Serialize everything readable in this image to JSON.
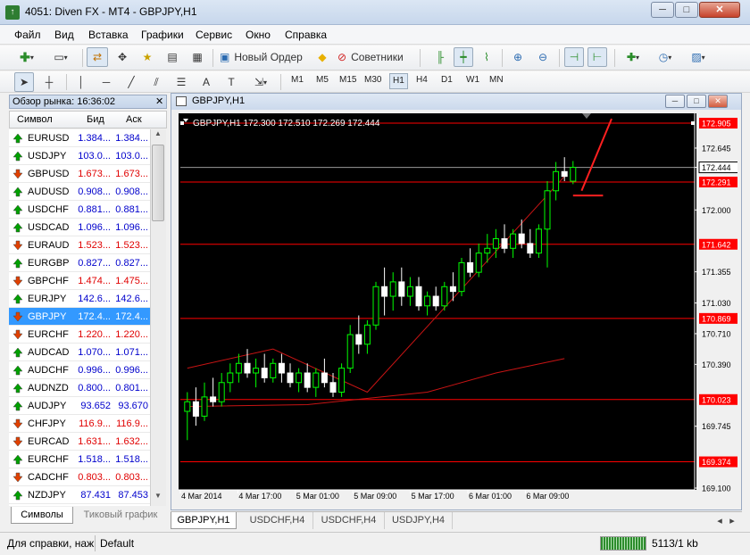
{
  "window": {
    "title": "4051: Diven FX - MT4 - GBPJPY,H1",
    "min": "─",
    "max": "□",
    "close": "✕"
  },
  "menu": [
    "Файл",
    "Вид",
    "Вставка",
    "Графики",
    "Сервис",
    "Окно",
    "Справка"
  ],
  "toolbar": {
    "new_order": "Новый Ордер",
    "advisors": "Советники"
  },
  "timeframes": [
    "M1",
    "M5",
    "M15",
    "M30",
    "H1",
    "H4",
    "D1",
    "W1",
    "MN"
  ],
  "market_watch": {
    "title": "Обзор рынка: 16:36:02",
    "close": "✕",
    "columns": {
      "symbol": "Символ",
      "bid": "Бид",
      "ask": "Аск"
    },
    "rows": [
      {
        "symbol": "EURUSD",
        "bid": "1.384...",
        "ask": "1.384...",
        "dir": "up"
      },
      {
        "symbol": "USDJPY",
        "bid": "103.0...",
        "ask": "103.0...",
        "dir": "up"
      },
      {
        "symbol": "GBPUSD",
        "bid": "1.673...",
        "ask": "1.673...",
        "dir": "down"
      },
      {
        "symbol": "AUDUSD",
        "bid": "0.908...",
        "ask": "0.908...",
        "dir": "up"
      },
      {
        "symbol": "USDCHF",
        "bid": "0.881...",
        "ask": "0.881...",
        "dir": "up"
      },
      {
        "symbol": "USDCAD",
        "bid": "1.096...",
        "ask": "1.096...",
        "dir": "up"
      },
      {
        "symbol": "EURAUD",
        "bid": "1.523...",
        "ask": "1.523...",
        "dir": "down"
      },
      {
        "symbol": "EURGBP",
        "bid": "0.827...",
        "ask": "0.827...",
        "dir": "up"
      },
      {
        "symbol": "GBPCHF",
        "bid": "1.474...",
        "ask": "1.475...",
        "dir": "down"
      },
      {
        "symbol": "EURJPY",
        "bid": "142.6...",
        "ask": "142.6...",
        "dir": "up"
      },
      {
        "symbol": "GBPJPY",
        "bid": "172.4...",
        "ask": "172.4...",
        "dir": "down",
        "selected": true
      },
      {
        "symbol": "EURCHF",
        "bid": "1.220...",
        "ask": "1.220...",
        "dir": "down"
      },
      {
        "symbol": "AUDCAD",
        "bid": "1.070...",
        "ask": "1.071...",
        "dir": "up"
      },
      {
        "symbol": "AUDCHF",
        "bid": "0.996...",
        "ask": "0.996...",
        "dir": "up"
      },
      {
        "symbol": "AUDNZD",
        "bid": "0.800...",
        "ask": "0.801...",
        "dir": "up"
      },
      {
        "symbol": "AUDJPY",
        "bid": "93.652",
        "ask": "93.670",
        "dir": "up"
      },
      {
        "symbol": "CHFJPY",
        "bid": "116.9...",
        "ask": "116.9...",
        "dir": "down"
      },
      {
        "symbol": "EURCAD",
        "bid": "1.631...",
        "ask": "1.632...",
        "dir": "down"
      },
      {
        "symbol": "EURCHF",
        "bid": "1.518...",
        "ask": "1.518...",
        "dir": "up"
      },
      {
        "symbol": "CADCHF",
        "bid": "0.803...",
        "ask": "0.803...",
        "dir": "down"
      },
      {
        "symbol": "NZDJPY",
        "bid": "87.431",
        "ask": "87.453",
        "dir": "up"
      }
    ],
    "tabs": [
      "Символы",
      "Тиковый график"
    ]
  },
  "chart_window": {
    "title": "GBPJPY,H1",
    "min": "─",
    "max": "□",
    "close": "✕"
  },
  "chart_tabs": [
    "GBPJPY,H1",
    "USDCHF,H4",
    "USDCHF,H4",
    "USDJPY,H4"
  ],
  "status": {
    "help": "Для справки, наж",
    "profile": "Default",
    "traffic": "5113/1 kb"
  },
  "colors": {
    "bg": "#000000",
    "bull": "#00ff00",
    "bear": "#ffffff",
    "level": "#ff0000",
    "up_arrow": "#00a000",
    "down_arrow": "#e04000"
  },
  "chart_data": {
    "type": "candlestick",
    "title": "GBPJPY,H1  172.300 172.510 172.269 172.444",
    "y_ticks": [
      "172.645",
      "172.444",
      "172.000",
      "171.355",
      "171.030",
      "170.710",
      "170.390",
      "169.745",
      "169.100"
    ],
    "ylim": [
      169.1,
      172.84
    ],
    "x_ticks": [
      "4 Mar 2014",
      "4 Mar 17:00",
      "5 Mar 01:00",
      "5 Mar 09:00",
      "5 Mar 17:00",
      "6 Mar 01:00",
      "6 Mar 09:00"
    ],
    "levels": [
      {
        "value": 172.905,
        "label": "172.905"
      },
      {
        "value": 172.291,
        "label": "172.291"
      },
      {
        "value": 171.642,
        "label": "171.642"
      },
      {
        "value": 170.869,
        "label": "170.869"
      },
      {
        "value": 170.023,
        "label": "170.023"
      },
      {
        "value": 169.374,
        "label": "169.374"
      }
    ],
    "current_price": "172.444",
    "candles": [
      {
        "o": 169.9,
        "h": 170.1,
        "l": 169.6,
        "c": 170.0
      },
      {
        "o": 170.0,
        "h": 170.15,
        "l": 169.75,
        "c": 169.85
      },
      {
        "o": 169.85,
        "h": 170.2,
        "l": 169.8,
        "c": 170.05
      },
      {
        "o": 170.05,
        "h": 170.25,
        "l": 169.95,
        "c": 170.0
      },
      {
        "o": 170.0,
        "h": 170.3,
        "l": 169.95,
        "c": 170.2
      },
      {
        "o": 170.2,
        "h": 170.4,
        "l": 170.1,
        "c": 170.3
      },
      {
        "o": 170.3,
        "h": 170.5,
        "l": 170.2,
        "c": 170.4
      },
      {
        "o": 170.4,
        "h": 170.55,
        "l": 170.25,
        "c": 170.3
      },
      {
        "o": 170.3,
        "h": 170.45,
        "l": 170.15,
        "c": 170.35
      },
      {
        "o": 170.35,
        "h": 170.5,
        "l": 170.2,
        "c": 170.25
      },
      {
        "o": 170.25,
        "h": 170.45,
        "l": 170.2,
        "c": 170.4
      },
      {
        "o": 170.4,
        "h": 170.5,
        "l": 170.2,
        "c": 170.3
      },
      {
        "o": 170.3,
        "h": 170.4,
        "l": 170.15,
        "c": 170.2
      },
      {
        "o": 170.2,
        "h": 170.35,
        "l": 170.1,
        "c": 170.3
      },
      {
        "o": 170.3,
        "h": 170.4,
        "l": 170.1,
        "c": 170.15
      },
      {
        "o": 170.15,
        "h": 170.35,
        "l": 170.05,
        "c": 170.3
      },
      {
        "o": 170.3,
        "h": 170.45,
        "l": 170.15,
        "c": 170.2
      },
      {
        "o": 170.2,
        "h": 170.3,
        "l": 170.05,
        "c": 170.1
      },
      {
        "o": 170.1,
        "h": 170.4,
        "l": 170.05,
        "c": 170.35
      },
      {
        "o": 170.35,
        "h": 170.8,
        "l": 170.3,
        "c": 170.7
      },
      {
        "o": 170.7,
        "h": 170.9,
        "l": 170.5,
        "c": 170.6
      },
      {
        "o": 170.6,
        "h": 170.85,
        "l": 170.5,
        "c": 170.8
      },
      {
        "o": 170.8,
        "h": 171.25,
        "l": 170.75,
        "c": 171.2
      },
      {
        "o": 171.2,
        "h": 171.4,
        "l": 170.9,
        "c": 171.1
      },
      {
        "o": 171.1,
        "h": 171.35,
        "l": 170.95,
        "c": 171.25
      },
      {
        "o": 171.25,
        "h": 171.4,
        "l": 171.0,
        "c": 171.1
      },
      {
        "o": 171.1,
        "h": 171.3,
        "l": 171.0,
        "c": 171.2
      },
      {
        "o": 171.2,
        "h": 171.3,
        "l": 170.95,
        "c": 171.0
      },
      {
        "o": 171.0,
        "h": 171.15,
        "l": 170.9,
        "c": 171.1
      },
      {
        "o": 171.1,
        "h": 171.2,
        "l": 170.95,
        "c": 171.0
      },
      {
        "o": 171.0,
        "h": 171.25,
        "l": 170.95,
        "c": 171.2
      },
      {
        "o": 171.2,
        "h": 171.35,
        "l": 171.05,
        "c": 171.15
      },
      {
        "o": 171.15,
        "h": 171.5,
        "l": 171.1,
        "c": 171.45
      },
      {
        "o": 171.45,
        "h": 171.6,
        "l": 171.3,
        "c": 171.35
      },
      {
        "o": 171.35,
        "h": 171.65,
        "l": 171.3,
        "c": 171.55
      },
      {
        "o": 171.55,
        "h": 171.75,
        "l": 171.45,
        "c": 171.6
      },
      {
        "o": 171.6,
        "h": 171.8,
        "l": 171.5,
        "c": 171.7
      },
      {
        "o": 171.7,
        "h": 171.85,
        "l": 171.55,
        "c": 171.6
      },
      {
        "o": 171.6,
        "h": 171.8,
        "l": 171.5,
        "c": 171.75
      },
      {
        "o": 171.75,
        "h": 171.9,
        "l": 171.6,
        "c": 171.65
      },
      {
        "o": 171.65,
        "h": 171.8,
        "l": 171.5,
        "c": 171.55
      },
      {
        "o": 171.55,
        "h": 171.85,
        "l": 171.5,
        "c": 171.8
      },
      {
        "o": 171.8,
        "h": 172.3,
        "l": 171.4,
        "c": 172.2
      },
      {
        "o": 172.2,
        "h": 172.5,
        "l": 172.1,
        "c": 172.4
      },
      {
        "o": 172.4,
        "h": 172.55,
        "l": 172.3,
        "c": 172.35
      },
      {
        "o": 172.3,
        "h": 172.51,
        "l": 172.269,
        "c": 172.444
      }
    ],
    "channel": [
      [
        0,
        170.35
      ],
      [
        10,
        170.55
      ],
      [
        21,
        170.1
      ],
      [
        44,
        172.35
      ]
    ],
    "ma": [
      [
        0,
        169.95
      ],
      [
        14,
        169.97
      ],
      [
        28,
        170.1
      ],
      [
        36,
        170.3
      ],
      [
        44,
        170.45
      ]
    ],
    "annotations": [
      {
        "type": "arrow",
        "from": [
          46,
          172.2
        ],
        "to": [
          49.5,
          172.95
        ]
      },
      {
        "type": "line",
        "from": [
          45,
          172.15
        ],
        "to": [
          48.5,
          172.15
        ]
      }
    ]
  }
}
